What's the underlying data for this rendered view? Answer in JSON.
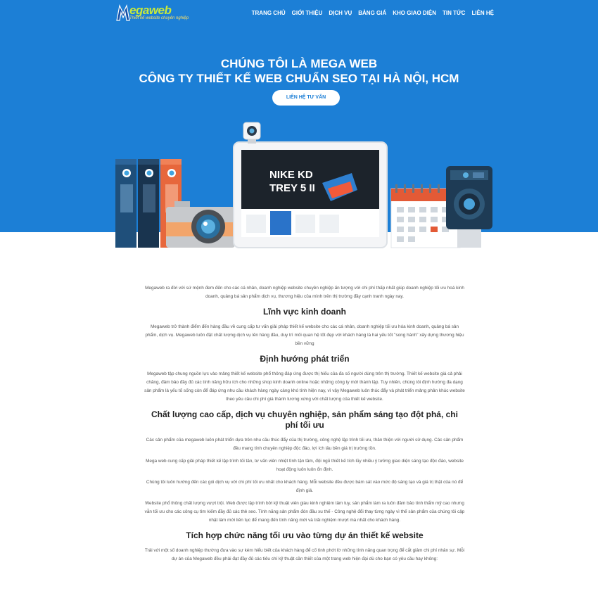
{
  "header": {
    "logo_text": "egaweb",
    "logo_tagline": "Thiết kế website chuyên nghiệp",
    "nav": [
      "TRANG CHỦ",
      "GIỚI THIỆU",
      "DỊCH VỤ",
      "BẢNG GIÁ",
      "KHO GIAO DIỆN",
      "TIN TỨC",
      "LIÊN HỆ"
    ]
  },
  "hero": {
    "title_line1": "CHÚNG TÔI LÀ MEGA WEB",
    "title_line2": "CÔNG TY THIẾT KẾ WEB CHUẨN SEO TẠI HÀ NỘI, HCM",
    "cta": "LIÊN HỆ TƯ VẤN",
    "screen_text": "NIKE KD TREY 5 II"
  },
  "content": {
    "intro": "Megaweb ra đời với sứ mệnh đem đến cho các cá nhân, doanh nghiệp website chuyên nghiệp ấn tượng với chi phí thấp nhất giúp doanh nghiệp tối ưu hoá kinh doanh, quảng bá sản phẩm dịch vụ, thương hiệu của mình trên thị trường đầy cạnh tranh ngày nay.",
    "h_linh_vuc": "Lĩnh vực kinh doanh",
    "p_linh_vuc": "Megaweb trở thành điểm đến hàng đầu về cung cấp tư vấn giải pháp thiết kế website cho các cá nhân, doanh nghiệp tối ưu hóa kinh doanh, quảng bá sản phẩm, dịch vụ. Megaweb luôn đặt chất lượng dịch vụ lên hàng đầu, duy trì mối quan hệ tốt đẹp với khách hàng là hai yếu tốt \"song hành\" xây dựng thương hiệu bền vững",
    "h_dinh_huong": "Định hướng phát triển",
    "p_dinh_huong": "Megaweb tập chung nguồn lực vào mảng thiết kế website phổ thông đáp ứng được thị hiếu của đa số người dùng trên thị trường. Thiết kế website giá cả phải chăng, đảm bảo đầy đủ các tính năng hữu ích cho những shop kinh doanh online hoặc những công ty mới thành lập. Tuy nhiên, chúng tôi định hướng đa dạng sản phẩm là yếu tố sống còn để đáp ứng nhu cầu khách hàng ngày càng khó tính hiện nay, vì vậy Megaweb luôn thúc đẩy và phát triển mảng phân khúc website theo yêu cầu chi phí giá thành tương xứng với chất lượng của thiết kế website.",
    "h_chat_luong": "Chất lượng cao cấp, dịch vụ chuyên nghiệp, sản phẩm sáng tạo đột phá, chi phí tối ưu",
    "p_chat_luong_1": "Các sản phẩm của megaweb luôn phát triển dựa trên nhu cầu thúc đẩy của thị trường, công nghệ lập trình tối ưu, thân thiện với người sử dụng. Các sản phẩm đều mang tính chuyên nghiệp độc đáo, lợi ích lâu bền giá trị trường tồn.",
    "p_chat_luong_2": "Mega web cung cấp giải pháp thiết kế lập trình tối tân, tư vấn viên nhiệt tình tận tâm, đội ngũ thiết kế tích lũy nhiều ý tưởng giao diện sáng tạo độc đáo, website hoạt động luôn luôn ổn định.",
    "p_chat_luong_3": "Chúng tôi luôn hướng đến các gói dịch vụ với chi phí tối ưu nhất cho khách hàng. Mỗi website đều được bám sát vào mức độ sáng tạo và giá trị thật của nó để định giá.",
    "p_chat_luong_4": "Website phổ thông chất lượng vượt trội. Web được lập trình bởi kỹ thuật viên giàu kinh nghiệm tâm tuy, sản phẩm làm ra luôn đảm bảo tính thẩm mỹ cao nhưng vẫn tối ưu cho các công cụ tìm kiếm đầy đủ các thẻ seo. Tính năng sản phẩm đón đầu xu thế - Công nghệ đổi thay từng ngày vì thế sản phẩm của chúng tôi cập nhật làm mới liên tục để mang đến tính năng mới và trải nghiệm mượt mà nhất cho khách hàng.",
    "h_tich_hop": "Tích hợp chức năng tối ưu vào từng dự án thiết kế website",
    "p_tich_hop": "Trải với một số doanh nghiệp thường đưa vào sự kém hiểu biết của khách hàng để cố tình phớt lờ những tính năng quan trọng để cắt giảm chi phí nhân sự. Mỗi dự án của Megaweb đều phải đạt đầy đủ các tiêu chí kỹ thuật cần thiết của một trang web hiện đại dù cho bạn có yêu cầu hay không:"
  },
  "colors": {
    "primary": "#1c7fd6",
    "logo_green": "#c8e93a"
  }
}
